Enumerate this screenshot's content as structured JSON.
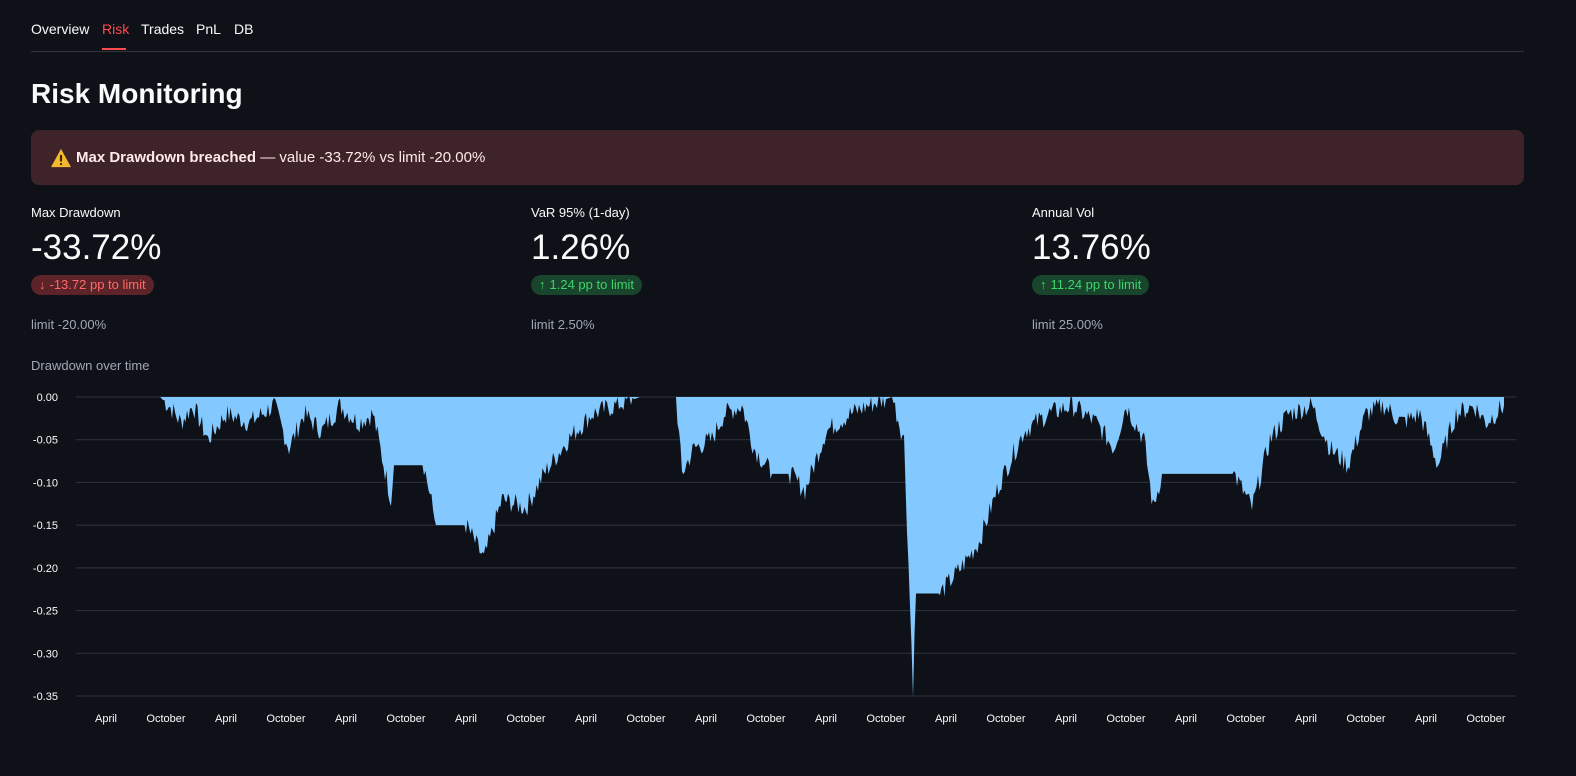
{
  "tabs": [
    {
      "label": "Overview",
      "active": false
    },
    {
      "label": "Risk",
      "active": true
    },
    {
      "label": "Trades",
      "active": false
    },
    {
      "label": "PnL",
      "active": false
    },
    {
      "label": "DB",
      "active": false
    }
  ],
  "page_title": "Risk Monitoring",
  "alert": {
    "icon": "warning-icon",
    "bold": "Max Drawdown breached",
    "rest": " — value -33.72% vs limit -20.00%"
  },
  "metrics": [
    {
      "label": "Max Drawdown",
      "value": "-33.72%",
      "delta": "-13.72 pp to limit",
      "direction": "down",
      "limit": "limit -20.00%"
    },
    {
      "label": "VaR 95% (1-day)",
      "value": "1.26%",
      "delta": "1.24 pp to limit",
      "direction": "up",
      "limit": "limit 2.50%"
    },
    {
      "label": "Annual Vol",
      "value": "13.76%",
      "delta": "11.24 pp to limit",
      "direction": "up",
      "limit": "limit 25.00%"
    }
  ],
  "colors": {
    "accent": "#ff4b4b",
    "area_fill": "#83c9ff",
    "negative": "#ff6b6b",
    "positive": "#3dd56d",
    "alert_bg": "#3e2428"
  },
  "chart_data": {
    "type": "area",
    "title": "Drawdown over time",
    "xlabel": "",
    "ylabel": "",
    "ylim": [
      -0.35,
      0.0
    ],
    "y_ticks": [
      "0.00",
      "-0.05",
      "-0.10",
      "-0.15",
      "-0.20",
      "-0.25",
      "-0.30",
      "-0.35"
    ],
    "x_ticks": [
      "April",
      "October",
      "April",
      "October",
      "April",
      "October",
      "April",
      "October",
      "April",
      "October",
      "April",
      "October",
      "April",
      "October",
      "April",
      "October",
      "April",
      "October",
      "April",
      "October",
      "April",
      "October",
      "April",
      "October"
    ],
    "grid": true,
    "series": [
      {
        "values": [
          [
            0.0,
            0.0
          ],
          [
            1.4,
            0.0
          ],
          [
            1.55,
            -0.01
          ],
          [
            1.75,
            -0.03
          ],
          [
            1.95,
            -0.01
          ],
          [
            2.2,
            -0.05
          ],
          [
            2.5,
            -0.02
          ],
          [
            2.9,
            -0.03
          ],
          [
            3.3,
            -0.01
          ],
          [
            3.55,
            -0.06
          ],
          [
            3.8,
            -0.02
          ],
          [
            4.1,
            -0.04
          ],
          [
            4.4,
            -0.01
          ],
          [
            4.7,
            -0.03
          ],
          [
            4.95,
            -0.02
          ],
          [
            5.25,
            -0.12
          ],
          [
            5.3,
            -0.08
          ],
          [
            5.8,
            -0.08
          ],
          [
            6.0,
            -0.15
          ],
          [
            6.5,
            -0.15
          ],
          [
            6.8,
            -0.19
          ],
          [
            7.1,
            -0.12
          ],
          [
            7.5,
            -0.13
          ],
          [
            7.8,
            -0.09
          ],
          [
            8.2,
            -0.05
          ],
          [
            8.6,
            -0.02
          ],
          [
            9.0,
            -0.01
          ],
          [
            9.4,
            0.0
          ],
          [
            10.0,
            0.0
          ],
          [
            10.1,
            -0.09
          ],
          [
            10.3,
            -0.06
          ],
          [
            10.6,
            -0.05
          ],
          [
            10.8,
            -0.02
          ],
          [
            11.1,
            -0.01
          ],
          [
            11.3,
            -0.06
          ],
          [
            11.6,
            -0.09
          ],
          [
            11.9,
            -0.09
          ],
          [
            12.15,
            -0.11
          ],
          [
            12.5,
            -0.04
          ],
          [
            12.9,
            -0.02
          ],
          [
            13.2,
            -0.01
          ],
          [
            13.6,
            0.0
          ],
          [
            13.8,
            -0.05
          ],
          [
            13.95,
            -0.34
          ],
          [
            14.0,
            -0.23
          ],
          [
            14.4,
            -0.23
          ],
          [
            14.75,
            -0.2
          ],
          [
            15.05,
            -0.17
          ],
          [
            15.4,
            -0.1
          ],
          [
            15.8,
            -0.04
          ],
          [
            16.2,
            -0.02
          ],
          [
            16.6,
            -0.01
          ],
          [
            17.0,
            -0.03
          ],
          [
            17.3,
            -0.06
          ],
          [
            17.5,
            -0.01
          ],
          [
            17.8,
            -0.05
          ],
          [
            17.95,
            -0.13
          ],
          [
            18.1,
            -0.09
          ],
          [
            19.3,
            -0.09
          ],
          [
            19.6,
            -0.13
          ],
          [
            19.9,
            -0.05
          ],
          [
            20.2,
            -0.02
          ],
          [
            20.6,
            -0.01
          ],
          [
            20.9,
            -0.06
          ],
          [
            21.2,
            -0.08
          ],
          [
            21.5,
            -0.02
          ],
          [
            21.8,
            -0.01
          ],
          [
            22.1,
            -0.03
          ],
          [
            22.4,
            -0.02
          ],
          [
            22.7,
            -0.08
          ],
          [
            23.0,
            -0.02
          ],
          [
            23.3,
            -0.01
          ],
          [
            23.5,
            -0.03
          ],
          [
            23.8,
            -0.01
          ]
        ]
      }
    ]
  }
}
